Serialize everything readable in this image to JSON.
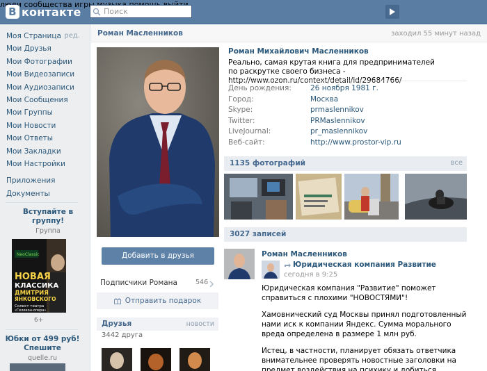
{
  "header": {
    "logo_text": "контакте",
    "logo_letter": "В",
    "search_placeholder": "Поиск",
    "nav": [
      "люди",
      "сообщества",
      "игры",
      "музыка",
      "помощь",
      "выйти"
    ]
  },
  "sidebar": {
    "items": [
      {
        "label": "Моя Страница",
        "edit": "ред."
      },
      {
        "label": "Мои Друзья"
      },
      {
        "label": "Мои Фотографии"
      },
      {
        "label": "Мои Видеозаписи"
      },
      {
        "label": "Мои Аудиозаписи"
      },
      {
        "label": "Мои Сообщения"
      },
      {
        "label": "Мои Группы"
      },
      {
        "label": "Мои Новости"
      },
      {
        "label": "Мои Ответы"
      },
      {
        "label": "Мои Закладки"
      },
      {
        "label": "Мои Настройки"
      }
    ],
    "extra": [
      {
        "label": "Приложения"
      },
      {
        "label": "Документы"
      }
    ],
    "ad1": {
      "title": "Вступайте в группу!",
      "subtitle": "Группа",
      "badge": "NeoClassic",
      "poster_line1": "НОВАЯ",
      "poster_line2": "КЛАССИКА",
      "poster_line3": "ДМИТРИЯ",
      "poster_line4": "ЯНКОВСКОГО",
      "poster_line5": "Солист театра",
      "poster_line6": "«Геликон-опера»",
      "count": "6+"
    },
    "ad2": {
      "title": "Юбки от 499 руб! Спешите",
      "subtitle": "quelle.ru"
    }
  },
  "profile": {
    "title_name": "Роман Масленников",
    "last_seen": "заходил 55 минут назад",
    "full_name": "Роман Михайлович Масленников",
    "status": "Реально, самая крутая книга для предпринимателей по раскрутке своего бизнеса - http://www.ozon.ru/context/detail/id/29684766/",
    "info": [
      {
        "label": "День рождения:",
        "value": "26 ноября 1981 г."
      },
      {
        "label": "Город:",
        "value": "Москва"
      },
      {
        "label": "Skype:",
        "value": "prmaslennikov"
      },
      {
        "label": "Twitter:",
        "value": "PRMaslennikov"
      },
      {
        "label": "LiveJournal:",
        "value": "pr_maslennikov"
      },
      {
        "label": "Веб-сайт:",
        "value": "http://www.prostor-vip.ru"
      }
    ],
    "add_friend": "Добавить в друзья",
    "subscribers_label": "Подписчики Романа",
    "subscribers_count": "546",
    "gift_label": "Отправить подарок",
    "friends_title": "Друзья",
    "friends_link": "новости",
    "friends_count": "3442 друга"
  },
  "photos": {
    "title": "1135 фотографий",
    "all_link": "все"
  },
  "wall": {
    "title": "3027 записей",
    "post": {
      "author": "Роман Масленников",
      "repost_from": "Юридическая компания Развитие",
      "time": "сегодня в 9:25",
      "p1": "Юридическая компания \"Развитие\" поможет справиться с плохими \"НОВОСТЯМИ\"!",
      "p2": "Хамовнический суд Москвы принял подготовленный нами иск к компании Яндекс. Сумма морального вреда определена в размере 1 млн руб.",
      "p3": "Истец, в частности, планирует обязать ответчика внимательнее проверять новостные заголовки на предмет воздействия на психику и добиться исключения опасных"
    }
  },
  "colors": {
    "header_bg": "#597da3",
    "link": "#2b587a",
    "button": "#5e81a8"
  }
}
